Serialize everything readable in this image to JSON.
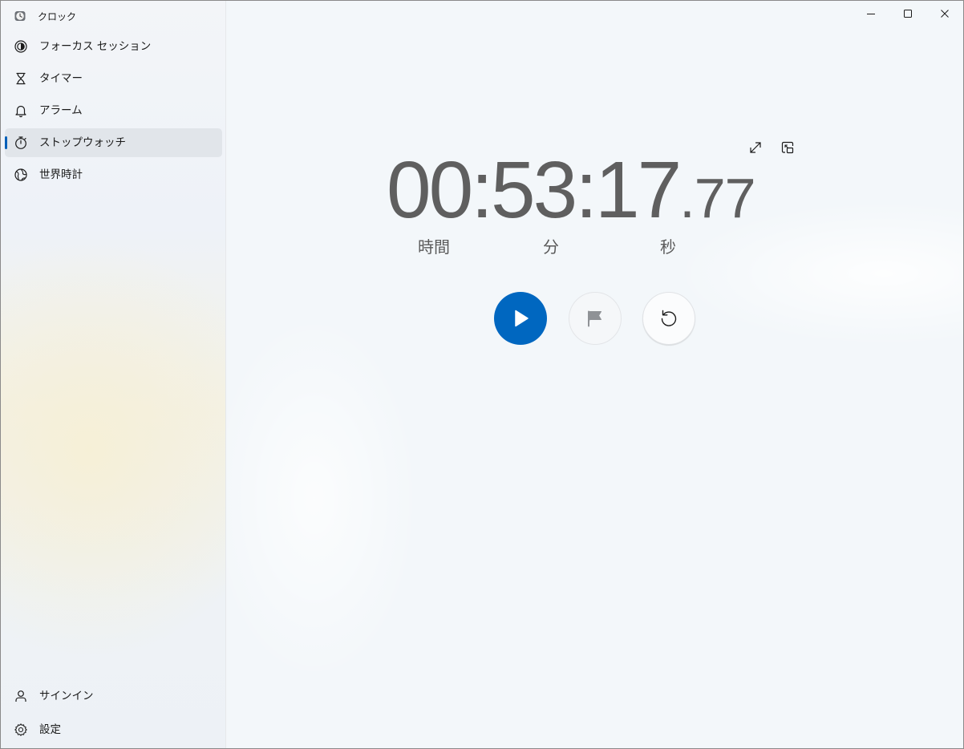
{
  "app": {
    "title": "クロック"
  },
  "sidebar": {
    "items": [
      {
        "label": "フォーカス セッション",
        "icon": "focus-icon"
      },
      {
        "label": "タイマー",
        "icon": "hourglass-icon"
      },
      {
        "label": "アラーム",
        "icon": "bell-icon"
      },
      {
        "label": "ストップウォッチ",
        "icon": "stopwatch-icon",
        "selected": true
      },
      {
        "label": "世界時計",
        "icon": "globe-icon"
      }
    ],
    "footer": [
      {
        "label": "サインイン",
        "icon": "person-icon"
      },
      {
        "label": "設定",
        "icon": "gear-icon"
      }
    ]
  },
  "stopwatch": {
    "time_main": "00:53:17",
    "time_fraction": ".77",
    "labels": {
      "hours": "時間",
      "minutes": "分",
      "seconds": "秒"
    }
  },
  "colors": {
    "accent": "#0067c0",
    "selected_bg": "#e2e5ea",
    "text": "#1a1a1a",
    "time_text": "#5f5f5f"
  }
}
